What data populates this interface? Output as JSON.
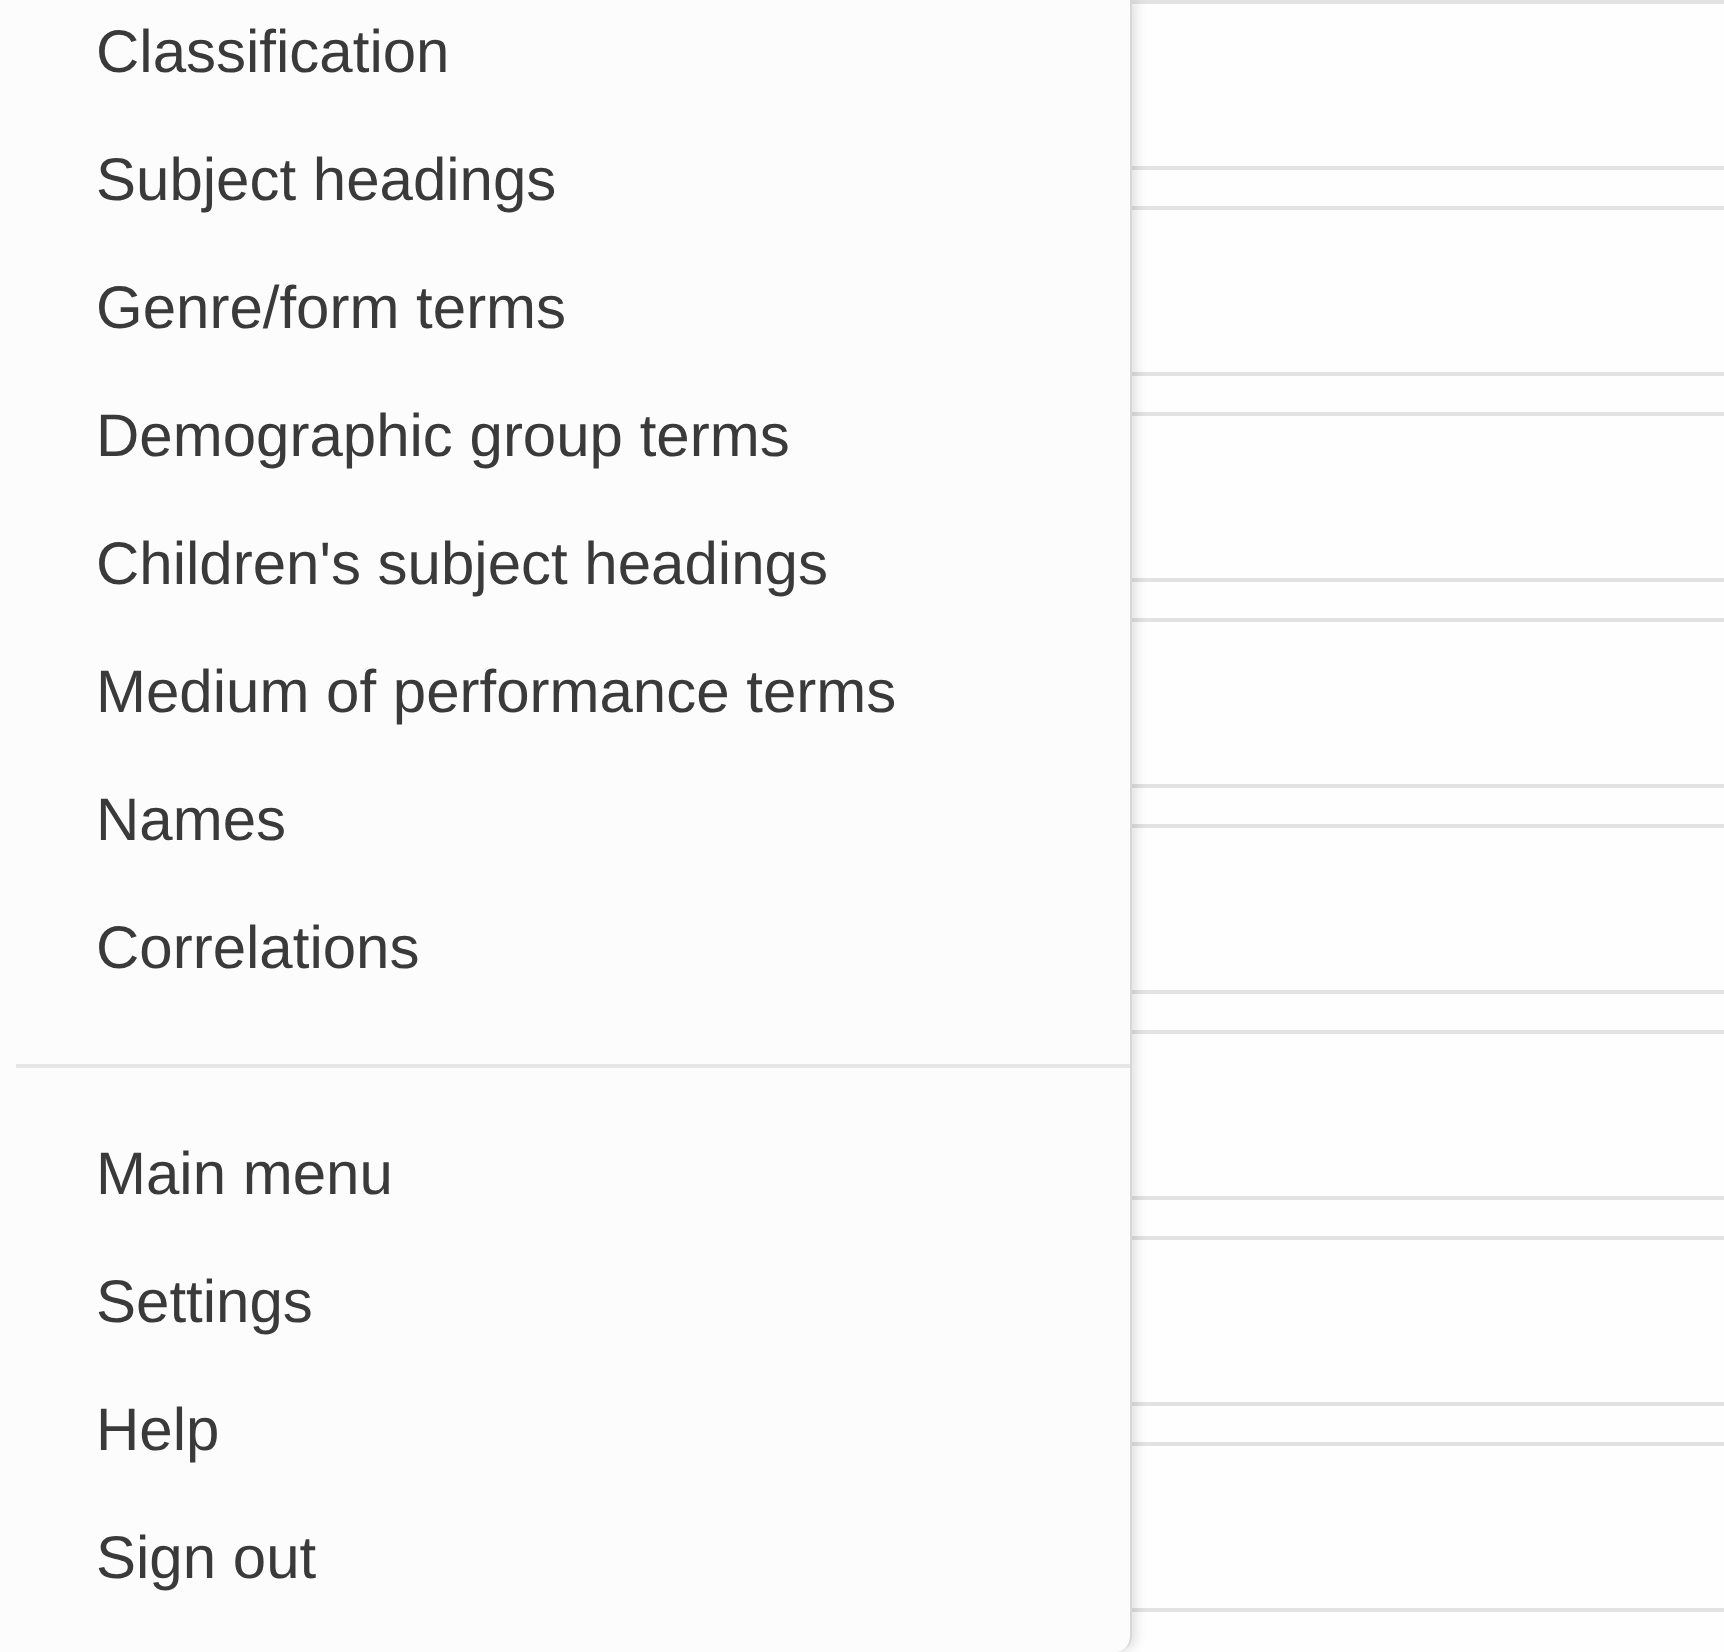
{
  "menu": {
    "sections": [
      {
        "items": [
          {
            "label": "Classification"
          },
          {
            "label": "Subject headings"
          },
          {
            "label": "Genre/form terms"
          },
          {
            "label": "Demographic group terms"
          },
          {
            "label": "Children's subject headings"
          },
          {
            "label": "Medium of performance terms"
          },
          {
            "label": "Names"
          },
          {
            "label": "Correlations"
          }
        ]
      },
      {
        "items": [
          {
            "label": "Main menu"
          },
          {
            "label": "Settings"
          },
          {
            "label": "Help"
          },
          {
            "label": "Sign out"
          }
        ]
      }
    ]
  }
}
